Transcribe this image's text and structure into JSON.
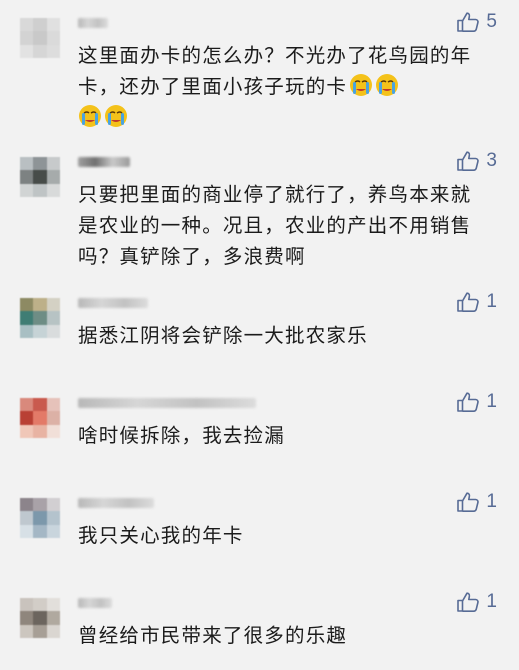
{
  "colors": {
    "link": "#576b95",
    "text": "#1b1b1b",
    "background": "#f2f2f2"
  },
  "comments": [
    {
      "likes": "5",
      "text": "这里面办卡的怎么办？不光办了花鸟园的年卡，还办了里面小孩子玩的卡",
      "emoji": [
        "crying-face",
        "crying-face",
        "crying-face",
        "crying-face"
      ]
    },
    {
      "likes": "3",
      "text": "只要把里面的商业停了就行了，养鸟本来就是农业的一种。况且，农业的产出不用销售吗？真铲除了，多浪费啊"
    },
    {
      "likes": "1",
      "text": "据悉江阴将会铲除一大批农家乐"
    },
    {
      "likes": "1",
      "text": "啥时候拆除，我去捡漏"
    },
    {
      "likes": "1",
      "text": "我只关心我的年卡"
    },
    {
      "likes": "1",
      "text": "曾经给市民带来了很多的乐趣"
    }
  ]
}
